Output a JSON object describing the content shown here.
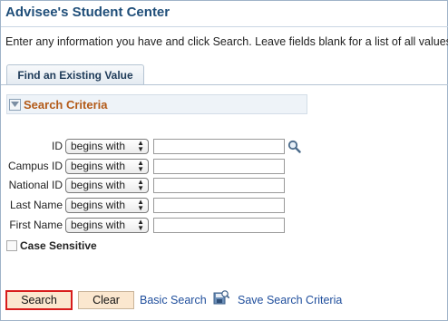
{
  "header": {
    "title": "Advisee's Student Center"
  },
  "instructions": "Enter any information you have and click Search. Leave fields blank for a list of all values.",
  "tabs": [
    {
      "label": "Find an Existing Value"
    }
  ],
  "section": {
    "title": "Search Criteria"
  },
  "fields": [
    {
      "label": "ID",
      "operator": "begins with",
      "value": ""
    },
    {
      "label": "Campus ID",
      "operator": "begins with",
      "value": ""
    },
    {
      "label": "National ID",
      "operator": "begins with",
      "value": ""
    },
    {
      "label": "Last Name",
      "operator": "begins with",
      "value": ""
    },
    {
      "label": "First Name",
      "operator": "begins with",
      "value": ""
    }
  ],
  "case_sensitive": {
    "label": "Case Sensitive",
    "checked": false
  },
  "actions": {
    "search_label": "Search",
    "clear_label": "Clear",
    "basic_search_label": "Basic Search",
    "save_criteria_label": "Save Search Criteria"
  },
  "colors": {
    "title": "#1f4e79",
    "section_title": "#b35a18",
    "link": "#1f4e9c",
    "button_bg": "#fbe7cf",
    "highlight_border": "#d81c1c"
  },
  "icons": {
    "collapse": "triangle-down-icon",
    "lookup": "magnifier-icon",
    "save_criteria": "save-search-icon",
    "operator_select": "up-down-arrows-icon"
  }
}
